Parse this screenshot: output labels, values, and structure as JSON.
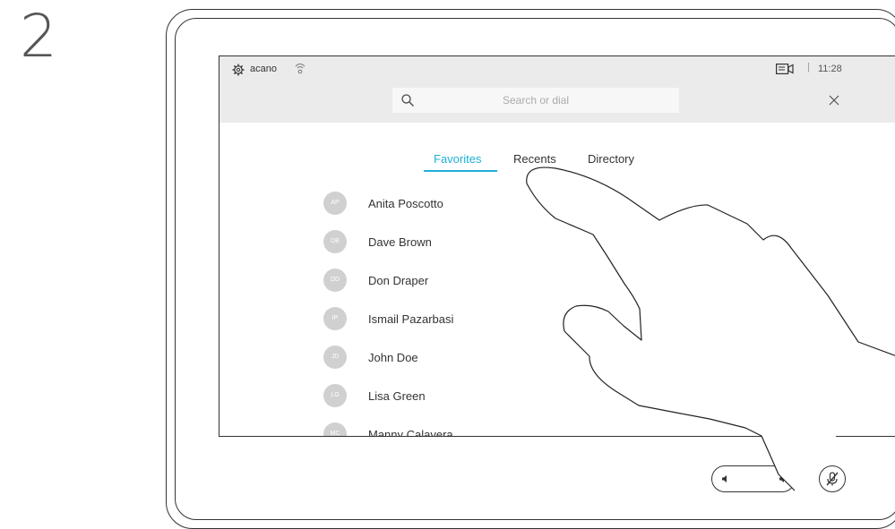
{
  "step": {
    "number": "2"
  },
  "status_bar": {
    "system_name": "acano",
    "separator": "|",
    "clock": "11:28"
  },
  "search": {
    "placeholder": "Search or dial"
  },
  "tabs": [
    {
      "label": "Favorites",
      "active": true
    },
    {
      "label": "Recents",
      "active": false
    },
    {
      "label": "Directory",
      "active": false
    }
  ],
  "contacts": [
    {
      "initials": "AP",
      "name": "Anita Poscotto"
    },
    {
      "initials": "DB",
      "name": "Dave Brown"
    },
    {
      "initials": "DD",
      "name": "Don Draper"
    },
    {
      "initials": "IP",
      "name": "Ismail Pazarbasi"
    },
    {
      "initials": "JD",
      "name": "John Doe"
    },
    {
      "initials": "LG",
      "name": "Lisa Green"
    },
    {
      "initials": "MC",
      "name": "Manny Calavera"
    }
  ],
  "colors": {
    "accent": "#1fb0d6",
    "topbar": "#ebebeb",
    "avatar": "#d0d0d0"
  },
  "icons": [
    "gear-icon",
    "wifi-icon",
    "camera-icon",
    "search-icon",
    "close-icon",
    "volume-down-icon",
    "volume-up-icon",
    "microphone-mute-icon",
    "hand-pointer-illustration"
  ]
}
